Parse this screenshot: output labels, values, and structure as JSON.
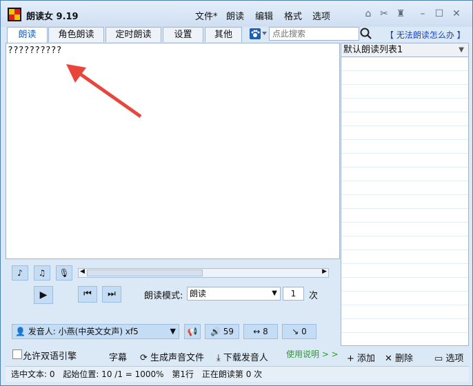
{
  "app": {
    "title": "朗读女 9.19"
  },
  "menu": [
    "文件*",
    "朗读",
    "编辑",
    "格式",
    "选项"
  ],
  "tabs": [
    "朗读",
    "角色朗读",
    "定时朗读",
    "设置",
    "其他"
  ],
  "search": {
    "placeholder": "点此搜索"
  },
  "help_link": "【 无法朗读怎么办 】",
  "editor": {
    "text": "??????????"
  },
  "playlist": {
    "selected": "默认朗读列表1"
  },
  "mode": {
    "label": "朗读模式:",
    "value": "朗读",
    "times_value": "1",
    "times_unit": "次"
  },
  "speaker": {
    "label": "发音人: 小燕(中英文女声) xf5",
    "volume": "59",
    "speed": "8",
    "pitch": "0"
  },
  "options": {
    "bilingual": "允许双语引擎",
    "subtitle": "字幕",
    "generate": "生成声音文件",
    "download": "下载发音人",
    "instructions": "使用说明 > >"
  },
  "list_actions": {
    "add": "添加",
    "delete": "删除",
    "options": "选项"
  },
  "status": {
    "selected": "选中文本: 0",
    "start": "起始位置: 10 /1 = 1000%",
    "line": "第1行",
    "reading": "正在朗读第 0 次"
  },
  "colors": {
    "accent": "#1c5fb4",
    "window": "#dbe8f6",
    "arrow": "#e8453c",
    "button": "#c5dcf5"
  }
}
